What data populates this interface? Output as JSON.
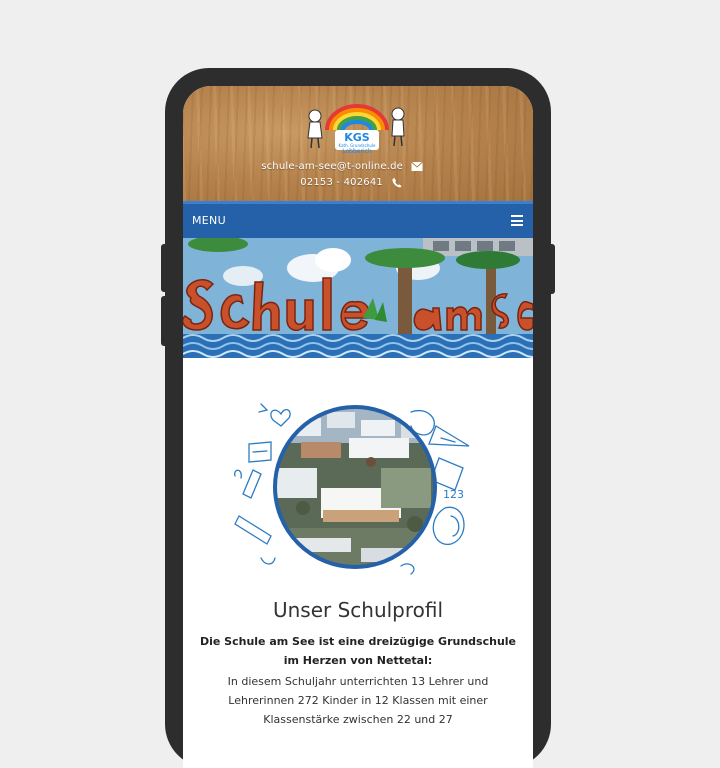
{
  "header": {
    "logo_text": "KGS",
    "logo_subtext": "Kath. Grundschule",
    "logo_town": "Lobberich",
    "email": "schule-am-see@t-online.de",
    "phone": "02153 - 402641",
    "email_icon": "envelope-icon",
    "phone_icon": "phone-icon"
  },
  "nav": {
    "menu_label": "MENU",
    "menu_icon": "hamburger-icon",
    "bar_color": "#2461a8"
  },
  "banner": {
    "graffiti_text": "Schule am See"
  },
  "main": {
    "title": "Unser Schulprofil",
    "lead": "Die Schule am See ist eine dreizügige Grundschule im Herzen von Nettetal:",
    "body": "In diesem Schuljahr unterrichten 13 Lehrer und Lehrerinnen 272 Kinder in 12 Klassen mit einer Klassenstärke zwischen 22 und 27"
  }
}
